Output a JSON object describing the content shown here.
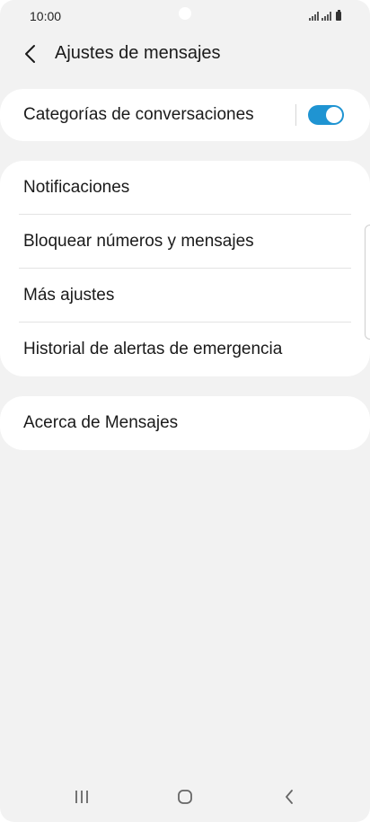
{
  "status_bar": {
    "time": "10:00",
    "icons": [
      "signal-icon",
      "signal-icon",
      "battery-icon"
    ]
  },
  "header": {
    "title": "Ajustes de mensajes",
    "back_icon": "chevron-left-icon"
  },
  "sections": {
    "conversation_categories": {
      "label": "Categorías de conversaciones",
      "toggle_on": true,
      "toggle_color": "#1f94d2"
    },
    "main_items": [
      {
        "label": "Notificaciones"
      },
      {
        "label": "Bloquear números y mensajes"
      },
      {
        "label": "Más ajustes"
      },
      {
        "label": "Historial de alertas de emergencia"
      }
    ],
    "about": {
      "label": "Acerca de Mensajes"
    }
  },
  "nav_bar": {
    "icons": [
      "recent-apps-icon",
      "home-icon",
      "back-icon"
    ]
  },
  "colors": {
    "background": "#f2f2f2",
    "card": "#ffffff",
    "accent": "#1f94d2"
  }
}
